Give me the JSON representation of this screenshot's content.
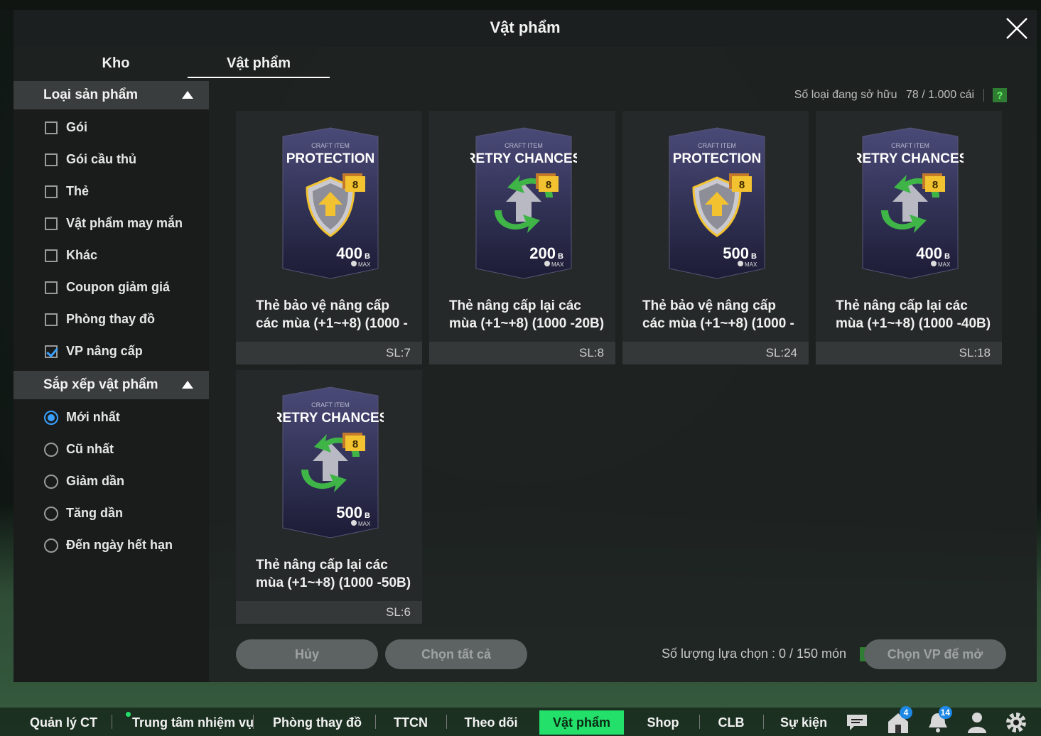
{
  "modal": {
    "title": "Vật phẩm",
    "tabs": [
      "Kho",
      "Vật phẩm"
    ],
    "active_tab": "Vật phẩm"
  },
  "filters": {
    "product_type": {
      "header": "Loại sản phẩm",
      "options": [
        {
          "label": "Gói",
          "checked": false
        },
        {
          "label": "Gói cầu thủ",
          "checked": false
        },
        {
          "label": "Thẻ",
          "checked": false
        },
        {
          "label": "Vật phẩm may mắn",
          "checked": false
        },
        {
          "label": "Khác",
          "checked": false
        },
        {
          "label": "Coupon giảm giá",
          "checked": false
        },
        {
          "label": "Phòng thay đồ",
          "checked": false
        },
        {
          "label": "VP nâng cấp",
          "checked": true
        }
      ]
    },
    "sort": {
      "header": "Sắp xếp vật phẩm",
      "options": [
        {
          "label": "Mới nhất",
          "selected": true
        },
        {
          "label": "Cũ nhất",
          "selected": false
        },
        {
          "label": "Giảm dần",
          "selected": false
        },
        {
          "label": "Tăng dần",
          "selected": false
        },
        {
          "label": "Đến ngày hết hạn",
          "selected": false
        }
      ]
    }
  },
  "owned_info": {
    "label": "Số loại đang sở hữu",
    "value": "78 / 1.000 cái",
    "help": "?"
  },
  "items": [
    {
      "kind": "protection",
      "craft": "CRAFT ITEM",
      "card_title": "PROTECTION",
      "level": "8",
      "amount": "400",
      "unit": "B",
      "max": "MAX",
      "name": "Thẻ bảo vệ nâng cấp các mùa (+1~+8) (1000 -",
      "qty": "SL:7"
    },
    {
      "kind": "retry",
      "craft": "CRAFT ITEM",
      "card_title": "RETRY CHANCES",
      "level": "8",
      "amount": "200",
      "unit": "B",
      "max": "MAX",
      "name": "Thẻ nâng cấp lại các mùa (+1~+8) (1000 -20B)",
      "qty": "SL:8"
    },
    {
      "kind": "protection",
      "craft": "CRAFT ITEM",
      "card_title": "PROTECTION",
      "level": "8",
      "amount": "500",
      "unit": "B",
      "max": "MAX",
      "name": "Thẻ bảo vệ nâng cấp các mùa (+1~+8) (1000 -",
      "qty": "SL:24"
    },
    {
      "kind": "retry",
      "craft": "CRAFT ITEM",
      "card_title": "RETRY CHANCES",
      "level": "8",
      "amount": "400",
      "unit": "B",
      "max": "MAX",
      "name": "Thẻ nâng cấp lại các mùa (+1~+8) (1000 -40B)",
      "qty": "SL:18"
    },
    {
      "kind": "retry",
      "craft": "CRAFT ITEM",
      "card_title": "RETRY CHANCES",
      "level": "8",
      "amount": "500",
      "unit": "B",
      "max": "MAX",
      "name": "Thẻ nâng cấp lại các mùa (+1~+8) (1000 -50B)",
      "qty": "SL:6"
    }
  ],
  "actions": {
    "cancel": "Hủy",
    "select_all": "Chọn tất cả",
    "selection_count": "Số lượng lựa chọn : 0 / 150 món",
    "help": "?",
    "open": "Chọn VP để mở"
  },
  "bottom_nav": {
    "items": [
      "Quản lý CT",
      "Trung tâm nhiệm vụ",
      "Phòng thay đồ",
      "TTCN",
      "Theo dõi",
      "Vật phẩm",
      "Shop",
      "CLB",
      "Sự kiện"
    ],
    "active": "Vật phẩm",
    "icons": [
      "chat-icon",
      "home-icon",
      "bell-icon",
      "profile-icon",
      "gear-icon"
    ],
    "home_badge": "4",
    "bell_badge": "14"
  },
  "colors": {
    "accent_green": "#22e06a",
    "selected_blue": "#3aa0ff",
    "card_gradient_top": "#4a4a78",
    "card_gradient_bottom": "#1c1c36",
    "gold": "#f2c230",
    "arrow_green": "#3fb548"
  }
}
